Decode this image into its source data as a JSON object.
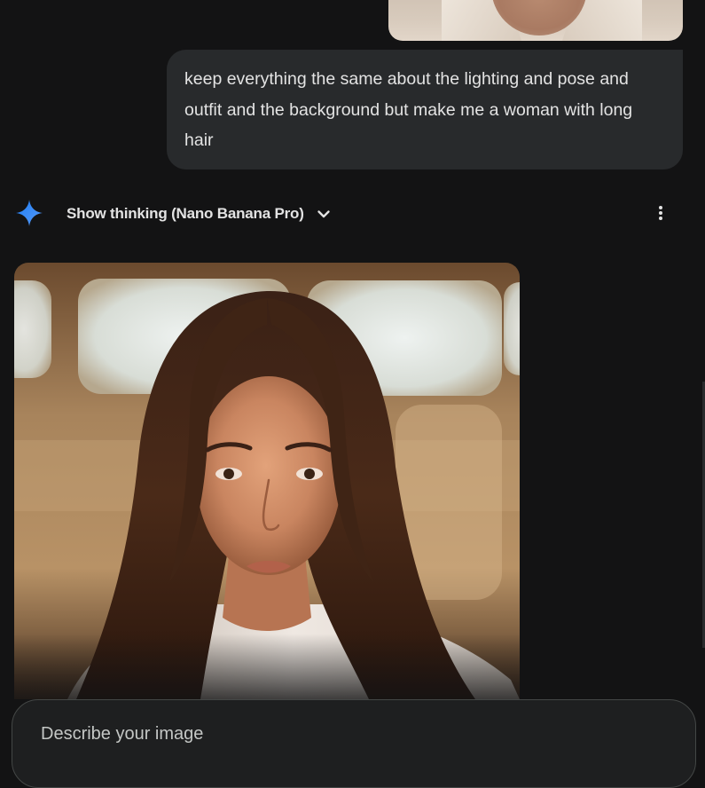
{
  "conversation": {
    "user_message": "keep everything the same about the lighting and pose and outfit and the background but make me a woman with long hair",
    "response": {
      "thinking_label": "Show thinking (Nano Banana Pro)"
    }
  },
  "composer": {
    "placeholder": "Describe your image"
  },
  "icons": {
    "sparkle": "gemini-sparkle-icon",
    "chevron": "chevron-down-icon",
    "more": "more-vert-icon"
  },
  "colors": {
    "background": "#131314",
    "bubble": "#282a2c",
    "text": "#e3e3e3",
    "sparkle_accent": "#4285f4"
  }
}
